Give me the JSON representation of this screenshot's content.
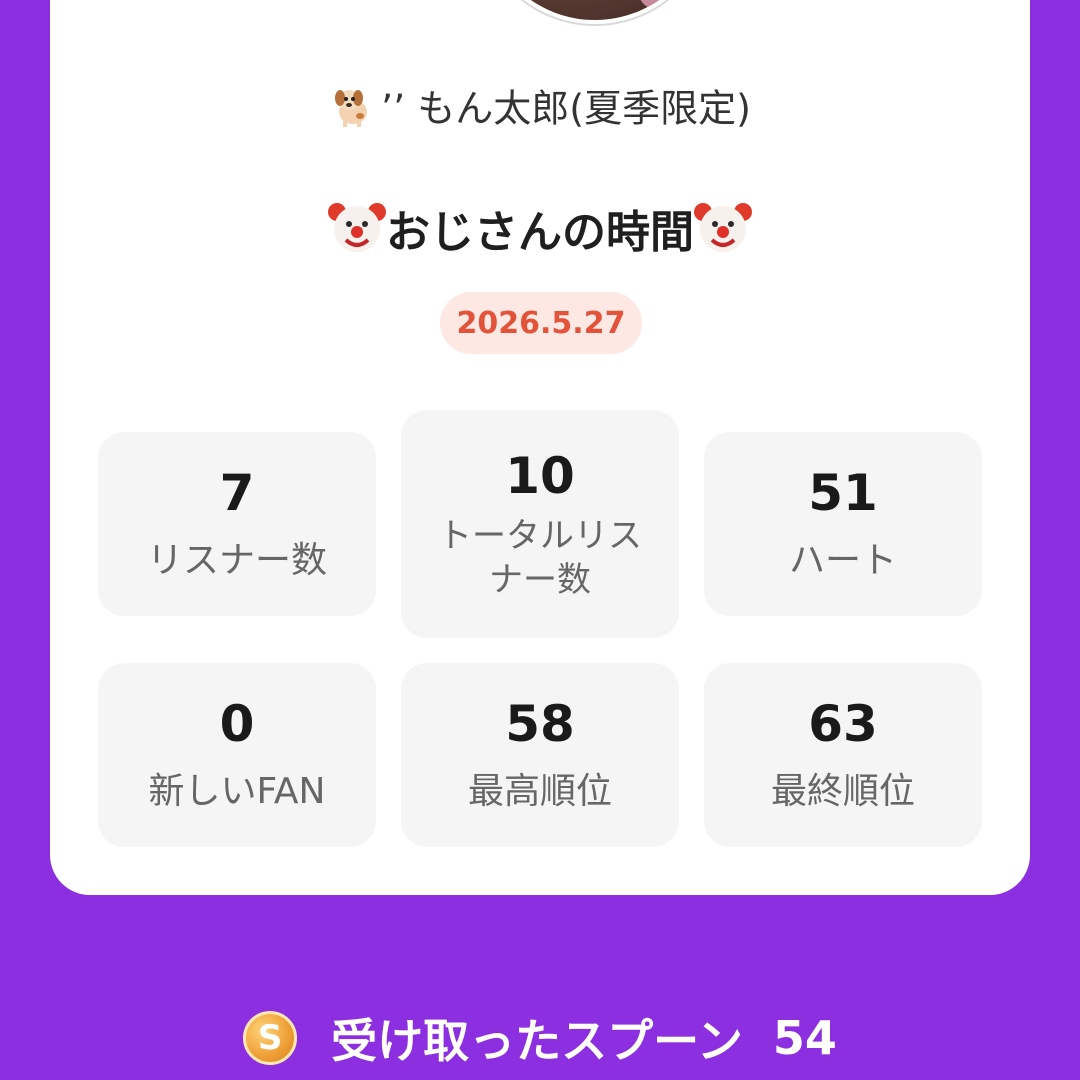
{
  "profile": {
    "username": "もん太郎(夏季限定)",
    "username_prefix": "’’"
  },
  "broadcast": {
    "title": "おじさんの時間",
    "date": "2026.5.27"
  },
  "stats": [
    {
      "value": "7",
      "label": "リスナー数"
    },
    {
      "value": "10",
      "label": "トータルリスナー数"
    },
    {
      "value": "51",
      "label": "ハート"
    },
    {
      "value": "0",
      "label": "新しいFAN"
    },
    {
      "value": "58",
      "label": "最高順位"
    },
    {
      "value": "63",
      "label": "最終順位"
    }
  ],
  "footer": {
    "coin_letter": "S",
    "label": "受け取ったスプーン",
    "count": "54"
  },
  "colors": {
    "background": "#8b2fe0",
    "date_text": "#e2533a",
    "date_badge": "#fde8e3"
  },
  "icons": [
    "dog-emoji-icon",
    "clown-emoji-icon",
    "spoon-coin-icon"
  ]
}
